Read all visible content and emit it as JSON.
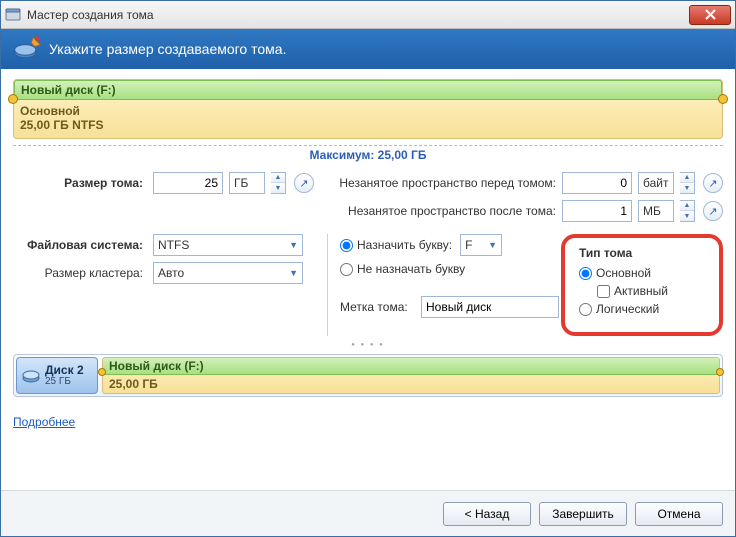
{
  "window": {
    "title": "Мастер создания тома"
  },
  "banner": {
    "text": "Укажите размер создаваемого тома."
  },
  "partition": {
    "name": "Новый диск (F:)",
    "type_line": "Основной",
    "size_line": "25,00 ГБ NTFS"
  },
  "max_label": "Максимум: 25,00 ГБ",
  "fields": {
    "volume_size_label": "Размер тома:",
    "volume_size_value": "25",
    "volume_size_unit": "ГБ",
    "unallocated_before_label": "Незанятое пространство перед томом:",
    "unallocated_before_value": "0",
    "unallocated_before_unit": "байт",
    "unallocated_after_label": "Незанятое пространство после тома:",
    "unallocated_after_value": "1",
    "unallocated_after_unit": "МБ",
    "filesystem_label": "Файловая система:",
    "filesystem_value": "NTFS",
    "cluster_label": "Размер кластера:",
    "cluster_value": "Авто",
    "assign_letter_label": "Назначить букву:",
    "assign_letter_value": "F",
    "no_assign_label": "Не назначать букву",
    "volume_label_label": "Метка тома:",
    "volume_label_value": "Новый диск"
  },
  "type_group": {
    "title": "Тип тома",
    "primary": "Основной",
    "active": "Активный",
    "logical": "Логический"
  },
  "disk": {
    "name": "Диск 2",
    "size": "25 ГБ",
    "part_name": "Новый диск (F:)",
    "part_size": "25,00 ГБ"
  },
  "more_link": "Подробнее",
  "footer": {
    "back": "< Назад",
    "finish": "Завершить",
    "cancel": "Отмена"
  }
}
